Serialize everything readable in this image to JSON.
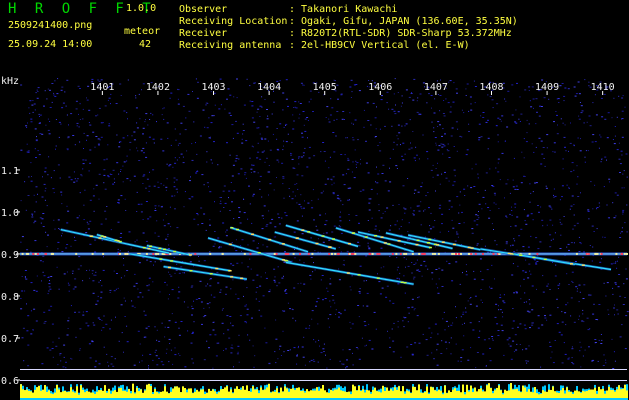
{
  "header": {
    "app_name": "H R O F F T",
    "version": "1.0.0",
    "filename": "2509241400.png",
    "datetime": "25.09.24 14:00",
    "meteor_label": "meteor",
    "meteor_count": "42",
    "info": [
      {
        "label": "Observer",
        "value": ": Takanori Kawachi"
      },
      {
        "label": "Receiving Location",
        "value": ": Ogaki, Gifu, JAPAN (136.60E, 35.35N)"
      },
      {
        "label": "Receiver",
        "value": ": R820T2(RTL-SDR) SDR-Sharp 53.372MHz"
      },
      {
        "label": "Receiving antenna",
        "value": ": 2el-HB9CV Vertical (el. E-W)"
      }
    ]
  },
  "colors": {
    "background": "#000000",
    "text_green": "#00d800",
    "text_yellow": "#ffff40",
    "text_white": "#f2f2f2",
    "signal_bar": "#ffff20",
    "noise_bar": "#00c8ff"
  },
  "chart_data": {
    "type": "heatmap",
    "y_unit": "kHz",
    "x_ticks": [
      "1401",
      "1402",
      "1403",
      "1404",
      "1405",
      "1406",
      "1407",
      "1408",
      "1409",
      "1410"
    ],
    "y_ticks": [
      "1.1",
      "1.0",
      "0.9",
      "0.8",
      "0.7",
      "0.6"
    ],
    "x_range": [
      1400.4,
      1410.15
    ],
    "y_range": [
      0.6,
      1.195
    ],
    "carrier_khz": 0.9,
    "meteor_traces": [
      {
        "start": [
          1400.25,
          0.958
        ],
        "end": [
          1402.2,
          0.902
        ]
      },
      {
        "start": [
          1400.9,
          0.946
        ],
        "end": [
          1401.3,
          0.93
        ]
      },
      {
        "start": [
          1401.8,
          0.92
        ],
        "end": [
          1402.6,
          0.897
        ]
      },
      {
        "start": [
          1403.3,
          0.963
        ],
        "end": [
          1404.7,
          0.905
        ]
      },
      {
        "start": [
          1404.1,
          0.952
        ],
        "end": [
          1405.2,
          0.912
        ]
      },
      {
        "start": [
          1404.3,
          0.968
        ],
        "end": [
          1405.6,
          0.918
        ]
      },
      {
        "start": [
          1405.2,
          0.962
        ],
        "end": [
          1406.6,
          0.905
        ]
      },
      {
        "start": [
          1405.6,
          0.952
        ],
        "end": [
          1406.9,
          0.915
        ]
      },
      {
        "start": [
          1406.1,
          0.95
        ],
        "end": [
          1407.3,
          0.913
        ]
      },
      {
        "start": [
          1406.5,
          0.945
        ],
        "end": [
          1407.8,
          0.91
        ]
      },
      {
        "start": [
          1402.9,
          0.938
        ],
        "end": [
          1404.4,
          0.88
        ]
      },
      {
        "start": [
          1401.5,
          0.9
        ],
        "end": [
          1403.3,
          0.86
        ]
      },
      {
        "start": [
          1402.1,
          0.87
        ],
        "end": [
          1403.6,
          0.84
        ]
      },
      {
        "start": [
          1404.3,
          0.88
        ],
        "end": [
          1406.6,
          0.828
        ]
      },
      {
        "start": [
          1407.8,
          0.912
        ],
        "end": [
          1410.15,
          0.863
        ]
      },
      {
        "start": [
          1408.4,
          0.9
        ],
        "end": [
          1409.5,
          0.875
        ]
      }
    ],
    "grid": false
  }
}
